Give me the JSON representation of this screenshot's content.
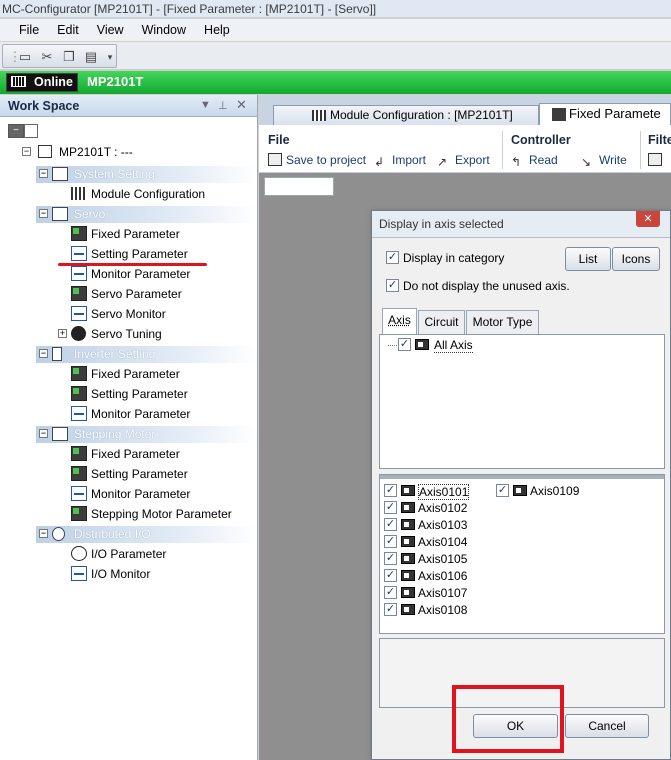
{
  "window": {
    "title": "MC-Configurator [MP2101T] - [Fixed Parameter : [MP2101T] - [Servo]]"
  },
  "menu": [
    "File",
    "Edit",
    "View",
    "Window",
    "Help"
  ],
  "status": {
    "online_label": "Online",
    "controller": "MP2101T"
  },
  "workspace": {
    "title": "Work Space",
    "pin_icon": "pin-icon",
    "close_icon": "close-icon",
    "root_label": "MP2101T : ---",
    "groups": [
      {
        "label": "System Setting",
        "items": [
          "Module Configuration"
        ]
      },
      {
        "label": "Servo",
        "items": [
          "Fixed Parameter",
          "Setting Parameter",
          "Monitor Parameter",
          "Servo Parameter",
          "Servo Monitor",
          "Servo Tuning"
        ]
      },
      {
        "label": "Inverter Setting",
        "items": [
          "Fixed Parameter",
          "Setting Parameter",
          "Monitor Parameter"
        ]
      },
      {
        "label": "Stepping Motor",
        "items": [
          "Fixed Parameter",
          "Setting Parameter",
          "Monitor Parameter",
          "Stepping Motor Parameter"
        ]
      },
      {
        "label": "Distributed I/O",
        "items": [
          "I/O Parameter",
          "I/O Monitor"
        ]
      }
    ]
  },
  "tabs": [
    {
      "label": "Module Configuration : [MP2101T]"
    },
    {
      "label": "Fixed Paramete"
    }
  ],
  "ribbon": {
    "file_title": "File",
    "save_label": "Save to project",
    "import_label": "Import",
    "export_label": "Export",
    "controller_title": "Controller",
    "read_label": "Read",
    "write_label": "Write",
    "filter_title": "Filte"
  },
  "dialog": {
    "title": "Display in axis selected",
    "display_in_category": "Display in category",
    "do_not_display_unused": "Do not display the unused axis.",
    "list_button": "List",
    "icons_button": "Icons",
    "tabs": [
      "Axis",
      "Circuit",
      "Motor Type"
    ],
    "all_axis_label": "All Axis",
    "axes_col1": [
      "Axis0101",
      "Axis0102",
      "Axis0103",
      "Axis0104",
      "Axis0105",
      "Axis0106",
      "Axis0107",
      "Axis0108"
    ],
    "axes_col2": [
      "Axis0109"
    ],
    "ok_button": "OK",
    "cancel_button": "Cancel"
  },
  "colors": {
    "online_green": "#1fbe3c",
    "highlight_red": "#e0141e"
  }
}
